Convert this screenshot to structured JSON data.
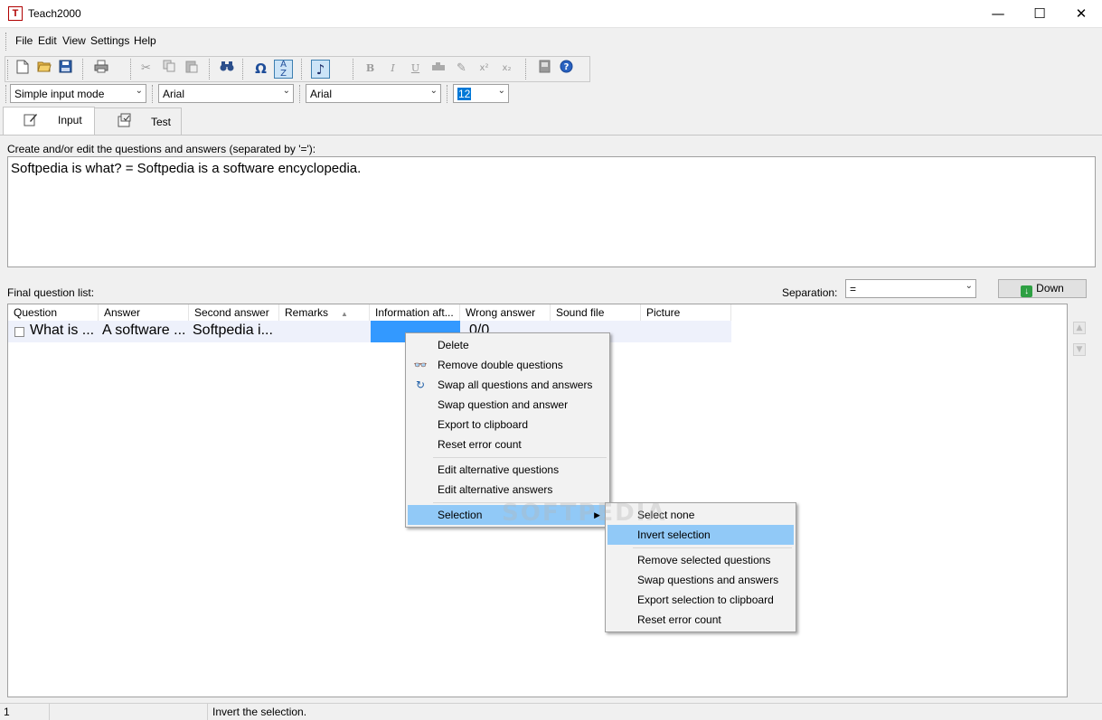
{
  "window": {
    "title": "Teach2000",
    "icon_letter": "T",
    "minimize": "—",
    "maximize": "☐",
    "close": "✕"
  },
  "menu": [
    "File",
    "Edit",
    "View",
    "Settings",
    "Help"
  ],
  "format_toolbar": {
    "mode": "Simple input mode",
    "question_font": "Arial",
    "answer_font": "Arial",
    "font_size": "12"
  },
  "tabs": [
    {
      "label": "Input"
    },
    {
      "label": "Test"
    }
  ],
  "input": {
    "label": "Create and/or edit the questions and answers (separated by '='):",
    "text": "Softpedia is what? = Softpedia is a software encyclopedia."
  },
  "list": {
    "label": "Final question list:",
    "separation_label": "Separation:",
    "separation_value": "=",
    "down_label": "Down",
    "columns": [
      "Question",
      "Answer",
      "Second answer",
      "Remarks",
      "Information aft...",
      "Wrong answer",
      "Sound file",
      "Picture"
    ],
    "sort_indicator": "▲",
    "rows": [
      {
        "question": "What is ...",
        "answer": "A software ...",
        "second_answer": "Softpedia i...",
        "remarks": "",
        "information_after": "",
        "wrong_answer": "0/0",
        "sound_file": "",
        "picture": ""
      }
    ]
  },
  "context_menu": {
    "items": [
      "Delete",
      "Remove double questions",
      "Swap all questions and answers",
      "Swap question and answer",
      "Export to clipboard",
      "Reset error count",
      "Edit alternative questions",
      "Edit alternative answers",
      "Selection"
    ],
    "icons": {
      "remove_double": "binoculars-icon",
      "swap_all": "refresh-icon"
    }
  },
  "submenu": {
    "items": [
      "Select none",
      "Invert selection",
      "Remove selected questions",
      "Swap questions and answers",
      "Export selection to clipboard",
      "Reset error count"
    ]
  },
  "watermark": "SOFTPEDIA",
  "status": {
    "panel1": "1",
    "panel2": "",
    "panel3": "Invert the selection."
  },
  "colors": {
    "selection_blue": "#3399ff",
    "menu_highlight": "#91c9f7",
    "row_bg": "#eef1fb"
  }
}
